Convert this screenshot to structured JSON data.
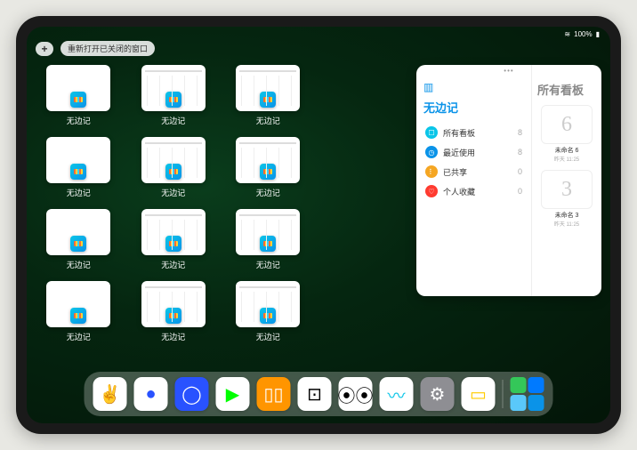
{
  "status": {
    "wifi": "⋮≋",
    "battery_pct": "100%"
  },
  "topbar": {
    "add_label": "+",
    "reopen_label": "重新打开已关闭的窗口"
  },
  "app_label": "无边记",
  "apps": [
    {
      "variant": "blank"
    },
    {
      "variant": "detail"
    },
    {
      "variant": "detail"
    },
    {
      "variant": "blank"
    },
    {
      "variant": "detail"
    },
    {
      "variant": "detail"
    },
    {
      "variant": "blank"
    },
    {
      "variant": "detail"
    },
    {
      "variant": "detail"
    },
    {
      "variant": "blank"
    },
    {
      "variant": "detail"
    },
    {
      "variant": "detail"
    }
  ],
  "panel": {
    "left_title": "无边记",
    "right_title": "所有看板",
    "categories": [
      {
        "icon_bg": "#0ac5e8",
        "sym": "☐",
        "label": "所有看板",
        "count": "8"
      },
      {
        "icon_bg": "#0a93e8",
        "sym": "◷",
        "label": "最近使用",
        "count": "8"
      },
      {
        "icon_bg": "#f5a623",
        "sym": "⠇",
        "label": "已共享",
        "count": "0"
      },
      {
        "icon_bg": "#ff3b30",
        "sym": "♡",
        "label": "个人收藏",
        "count": "0"
      }
    ],
    "boards": [
      {
        "glyph": "6",
        "label": "未命名 6",
        "sub": "昨天 11:25"
      },
      {
        "glyph": "3",
        "label": "未命名 3",
        "sub": "昨天 11:25"
      }
    ]
  },
  "dock": [
    {
      "name": "wechat",
      "bg": "#fff",
      "fg": "#07c160",
      "sym": "✌"
    },
    {
      "name": "quark-hd",
      "bg": "#fff",
      "fg": "#2952ff",
      "sym": "●"
    },
    {
      "name": "quark",
      "bg": "#2952ff",
      "fg": "#fff",
      "sym": "◯"
    },
    {
      "name": "play",
      "bg": "#fff",
      "fg": "#0f0",
      "sym": "▶"
    },
    {
      "name": "books",
      "bg": "#ff9500",
      "fg": "#fff",
      "sym": "▯▯"
    },
    {
      "name": "dice",
      "bg": "#fff",
      "fg": "#000",
      "sym": "⊡"
    },
    {
      "name": "connect",
      "bg": "#fff",
      "fg": "#000",
      "sym": "⦿⦿"
    },
    {
      "name": "freeform",
      "bg": "#fff",
      "fg": "#0ac5e8",
      "sym": "〰"
    },
    {
      "name": "settings",
      "bg": "#8e8e93",
      "fg": "#fff",
      "sym": "⚙"
    },
    {
      "name": "notes",
      "bg": "#fff",
      "fg": "#ffcc00",
      "sym": "▭"
    }
  ]
}
